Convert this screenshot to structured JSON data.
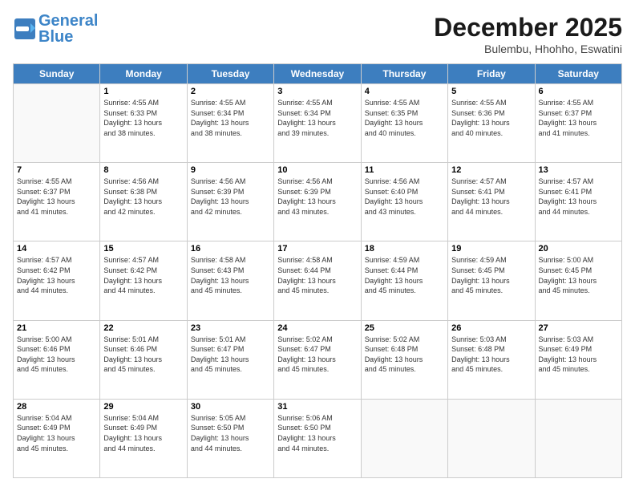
{
  "logo": {
    "text_general": "General",
    "text_blue": "Blue"
  },
  "header": {
    "month": "December 2025",
    "location": "Bulembu, Hhohho, Eswatini"
  },
  "days_of_week": [
    "Sunday",
    "Monday",
    "Tuesday",
    "Wednesday",
    "Thursday",
    "Friday",
    "Saturday"
  ],
  "weeks": [
    [
      {
        "day": "",
        "info": ""
      },
      {
        "day": "1",
        "info": "Sunrise: 4:55 AM\nSunset: 6:33 PM\nDaylight: 13 hours\nand 38 minutes."
      },
      {
        "day": "2",
        "info": "Sunrise: 4:55 AM\nSunset: 6:34 PM\nDaylight: 13 hours\nand 38 minutes."
      },
      {
        "day": "3",
        "info": "Sunrise: 4:55 AM\nSunset: 6:34 PM\nDaylight: 13 hours\nand 39 minutes."
      },
      {
        "day": "4",
        "info": "Sunrise: 4:55 AM\nSunset: 6:35 PM\nDaylight: 13 hours\nand 40 minutes."
      },
      {
        "day": "5",
        "info": "Sunrise: 4:55 AM\nSunset: 6:36 PM\nDaylight: 13 hours\nand 40 minutes."
      },
      {
        "day": "6",
        "info": "Sunrise: 4:55 AM\nSunset: 6:37 PM\nDaylight: 13 hours\nand 41 minutes."
      }
    ],
    [
      {
        "day": "7",
        "info": "Sunrise: 4:55 AM\nSunset: 6:37 PM\nDaylight: 13 hours\nand 41 minutes."
      },
      {
        "day": "8",
        "info": "Sunrise: 4:56 AM\nSunset: 6:38 PM\nDaylight: 13 hours\nand 42 minutes."
      },
      {
        "day": "9",
        "info": "Sunrise: 4:56 AM\nSunset: 6:39 PM\nDaylight: 13 hours\nand 42 minutes."
      },
      {
        "day": "10",
        "info": "Sunrise: 4:56 AM\nSunset: 6:39 PM\nDaylight: 13 hours\nand 43 minutes."
      },
      {
        "day": "11",
        "info": "Sunrise: 4:56 AM\nSunset: 6:40 PM\nDaylight: 13 hours\nand 43 minutes."
      },
      {
        "day": "12",
        "info": "Sunrise: 4:57 AM\nSunset: 6:41 PM\nDaylight: 13 hours\nand 44 minutes."
      },
      {
        "day": "13",
        "info": "Sunrise: 4:57 AM\nSunset: 6:41 PM\nDaylight: 13 hours\nand 44 minutes."
      }
    ],
    [
      {
        "day": "14",
        "info": "Sunrise: 4:57 AM\nSunset: 6:42 PM\nDaylight: 13 hours\nand 44 minutes."
      },
      {
        "day": "15",
        "info": "Sunrise: 4:57 AM\nSunset: 6:42 PM\nDaylight: 13 hours\nand 44 minutes."
      },
      {
        "day": "16",
        "info": "Sunrise: 4:58 AM\nSunset: 6:43 PM\nDaylight: 13 hours\nand 45 minutes."
      },
      {
        "day": "17",
        "info": "Sunrise: 4:58 AM\nSunset: 6:44 PM\nDaylight: 13 hours\nand 45 minutes."
      },
      {
        "day": "18",
        "info": "Sunrise: 4:59 AM\nSunset: 6:44 PM\nDaylight: 13 hours\nand 45 minutes."
      },
      {
        "day": "19",
        "info": "Sunrise: 4:59 AM\nSunset: 6:45 PM\nDaylight: 13 hours\nand 45 minutes."
      },
      {
        "day": "20",
        "info": "Sunrise: 5:00 AM\nSunset: 6:45 PM\nDaylight: 13 hours\nand 45 minutes."
      }
    ],
    [
      {
        "day": "21",
        "info": "Sunrise: 5:00 AM\nSunset: 6:46 PM\nDaylight: 13 hours\nand 45 minutes."
      },
      {
        "day": "22",
        "info": "Sunrise: 5:01 AM\nSunset: 6:46 PM\nDaylight: 13 hours\nand 45 minutes."
      },
      {
        "day": "23",
        "info": "Sunrise: 5:01 AM\nSunset: 6:47 PM\nDaylight: 13 hours\nand 45 minutes."
      },
      {
        "day": "24",
        "info": "Sunrise: 5:02 AM\nSunset: 6:47 PM\nDaylight: 13 hours\nand 45 minutes."
      },
      {
        "day": "25",
        "info": "Sunrise: 5:02 AM\nSunset: 6:48 PM\nDaylight: 13 hours\nand 45 minutes."
      },
      {
        "day": "26",
        "info": "Sunrise: 5:03 AM\nSunset: 6:48 PM\nDaylight: 13 hours\nand 45 minutes."
      },
      {
        "day": "27",
        "info": "Sunrise: 5:03 AM\nSunset: 6:49 PM\nDaylight: 13 hours\nand 45 minutes."
      }
    ],
    [
      {
        "day": "28",
        "info": "Sunrise: 5:04 AM\nSunset: 6:49 PM\nDaylight: 13 hours\nand 45 minutes."
      },
      {
        "day": "29",
        "info": "Sunrise: 5:04 AM\nSunset: 6:49 PM\nDaylight: 13 hours\nand 44 minutes."
      },
      {
        "day": "30",
        "info": "Sunrise: 5:05 AM\nSunset: 6:50 PM\nDaylight: 13 hours\nand 44 minutes."
      },
      {
        "day": "31",
        "info": "Sunrise: 5:06 AM\nSunset: 6:50 PM\nDaylight: 13 hours\nand 44 minutes."
      },
      {
        "day": "",
        "info": ""
      },
      {
        "day": "",
        "info": ""
      },
      {
        "day": "",
        "info": ""
      }
    ]
  ]
}
